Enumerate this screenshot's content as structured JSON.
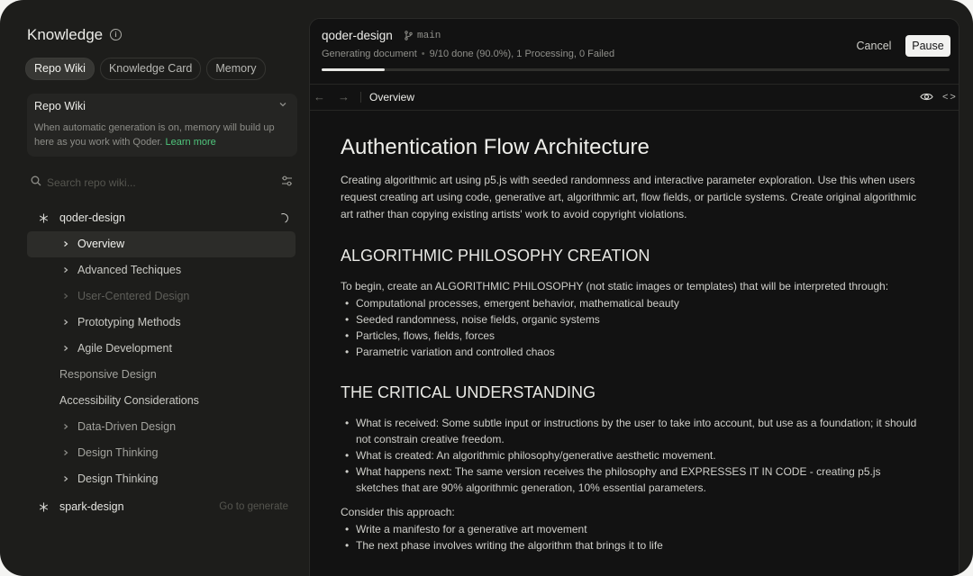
{
  "sidebar": {
    "title": "Knowledge",
    "tabs": [
      {
        "label": "Repo Wiki",
        "active": true
      },
      {
        "label": "Knowledge Card",
        "active": false
      },
      {
        "label": "Memory",
        "active": false
      }
    ],
    "wiki_card": {
      "title": "Repo Wiki",
      "description": "When automatic generation is on, memory will  build up here as you work with Qoder.",
      "link": "Learn more"
    },
    "search_placeholder": "Search repo wiki...",
    "tree": [
      {
        "label": "qoder-design",
        "type": "root",
        "icon": "snowflake-icon",
        "status": "loading-spinner"
      },
      {
        "label": "Overview",
        "level": 1,
        "chevron": true,
        "selected": true
      },
      {
        "label": "Advanced Techiques",
        "level": 1,
        "chevron": true
      },
      {
        "label": "User-Centered Design",
        "level": 1,
        "chevron": true,
        "state": "pending"
      },
      {
        "label": "Prototyping Methods",
        "level": 1,
        "chevron": true
      },
      {
        "label": "Agile Development",
        "level": 1,
        "chevron": true
      },
      {
        "label": "Responsive Design",
        "level": 0,
        "chevron": false
      },
      {
        "label": "Accessibility Considerations",
        "level": 0,
        "chevron": false
      },
      {
        "label": "Data-Driven Design",
        "level": 1,
        "chevron": true
      },
      {
        "label": "Design Thinking",
        "level": 1,
        "chevron": true
      },
      {
        "label": "Design Thinking",
        "level": 1,
        "chevron": true
      },
      {
        "label": "spark-design",
        "type": "root",
        "icon": "snowflake-icon",
        "action": "Go to generate"
      }
    ]
  },
  "header": {
    "project": "qoder-design",
    "branch": "main",
    "status_label": "Generating document",
    "status_detail": "9/10 done (90.0%), 1 Processing, 0 Failed",
    "progress": 0.1,
    "cancel_label": "Cancel",
    "pause_label": "Pause"
  },
  "nav": {
    "title": "Overview"
  },
  "doc": {
    "title": "Authentication Flow Architecture",
    "intro": "Creating algorithmic art using p5.js with seeded randomness and interactive parameter exploration. Use this when users request creating art using code, generative art, algorithmic art, flow fields, or particle systems. Create original algorithmic art rather than copying existing artists' work to avoid copyright violations.",
    "section1": {
      "heading": "ALGORITHMIC PHILOSOPHY CREATION",
      "text": "To begin, create an ALGORITHMIC PHILOSOPHY (not static images or templates) that will be interpreted through:",
      "bullets": [
        "Computational processes, emergent behavior, mathematical beauty",
        "Seeded randomness, noise fields, organic systems",
        "Particles, flows, fields, forces",
        "Parametric variation and controlled chaos"
      ]
    },
    "section2": {
      "heading": "THE CRITICAL UNDERSTANDING",
      "bullets": [
        "What is received: Some subtle input or instructions by the user to take into account, but use as a foundation; it should not constrain creative freedom.",
        "What is created: An algorithmic philosophy/generative aesthetic movement.",
        "What happens next: The same version receives the philosophy and EXPRESSES IT IN CODE - creating p5.js sketches that are 90% algorithmic generation, 10% essential parameters."
      ]
    },
    "section3": {
      "text": "Consider this approach:",
      "bullets": [
        "Write a manifesto for a generative art movement",
        "The next phase involves writing the algorithm that brings it to life"
      ]
    }
  }
}
